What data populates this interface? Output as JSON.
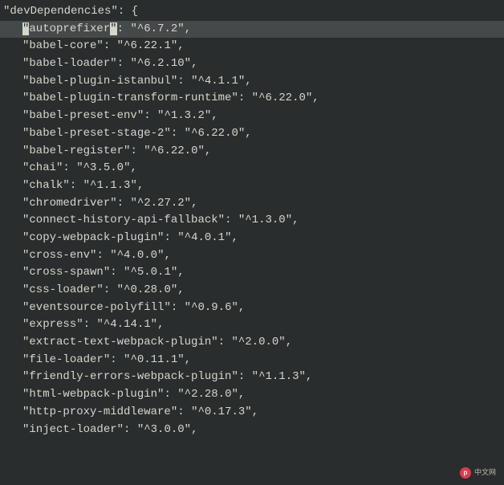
{
  "section_label": "devDependencies",
  "entries": [
    {
      "key": "autoprefixer",
      "value": "^6.7.2",
      "highlight": true
    },
    {
      "key": "babel-core",
      "value": "^6.22.1"
    },
    {
      "key": "babel-loader",
      "value": "^6.2.10"
    },
    {
      "key": "babel-plugin-istanbul",
      "value": "^4.1.1"
    },
    {
      "key": "babel-plugin-transform-runtime",
      "value": "^6.22.0"
    },
    {
      "key": "babel-preset-env",
      "value": "^1.3.2"
    },
    {
      "key": "babel-preset-stage-2",
      "value": "^6.22.0"
    },
    {
      "key": "babel-register",
      "value": "^6.22.0"
    },
    {
      "key": "chai",
      "value": "^3.5.0"
    },
    {
      "key": "chalk",
      "value": "^1.1.3"
    },
    {
      "key": "chromedriver",
      "value": "^2.27.2"
    },
    {
      "key": "connect-history-api-fallback",
      "value": "^1.3.0"
    },
    {
      "key": "copy-webpack-plugin",
      "value": "^4.0.1"
    },
    {
      "key": "cross-env",
      "value": "^4.0.0"
    },
    {
      "key": "cross-spawn",
      "value": "^5.0.1"
    },
    {
      "key": "css-loader",
      "value": "^0.28.0"
    },
    {
      "key": "eventsource-polyfill",
      "value": "^0.9.6"
    },
    {
      "key": "express",
      "value": "^4.14.1"
    },
    {
      "key": "extract-text-webpack-plugin",
      "value": "^2.0.0"
    },
    {
      "key": "file-loader",
      "value": "^0.11.1"
    },
    {
      "key": "friendly-errors-webpack-plugin",
      "value": "^1.1.3"
    },
    {
      "key": "html-webpack-plugin",
      "value": "^2.28.0"
    },
    {
      "key": "http-proxy-middleware",
      "value": "^0.17.3"
    },
    {
      "key": "inject-loader",
      "value": "^3.0.0"
    }
  ],
  "watermark": "中文网"
}
